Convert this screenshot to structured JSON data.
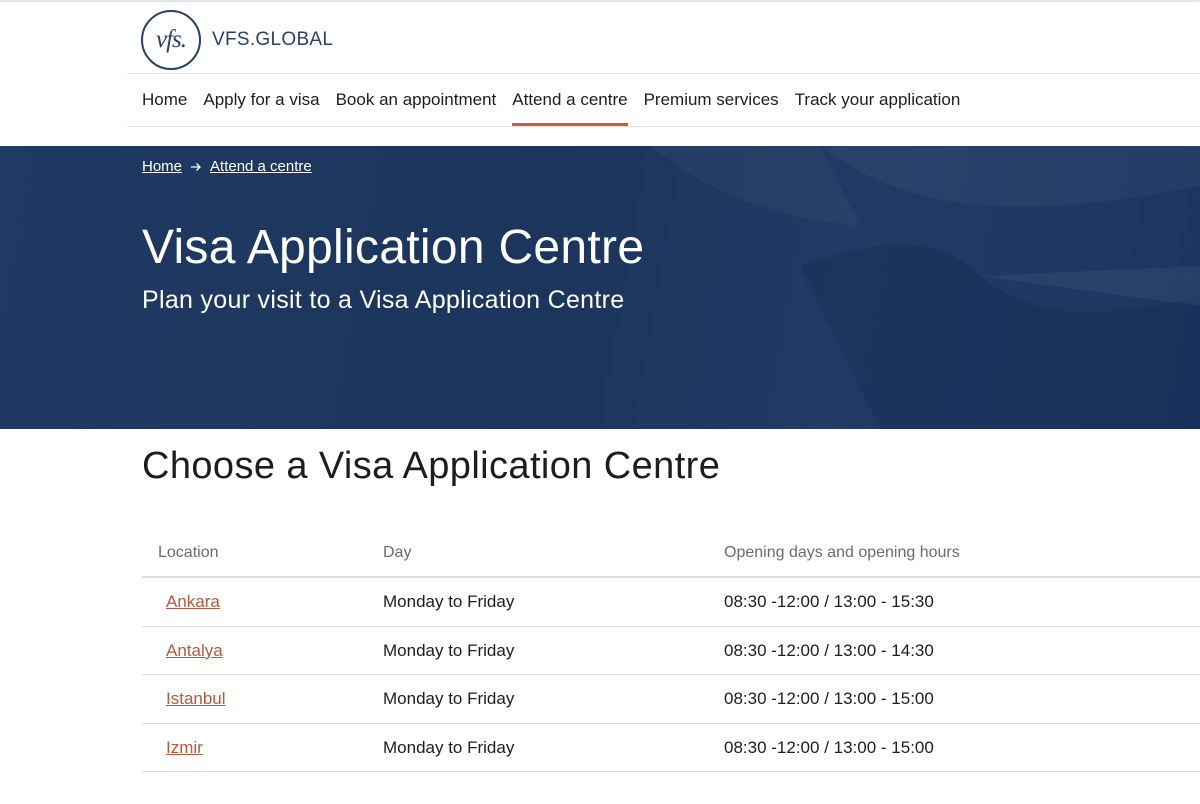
{
  "logo": {
    "mark": "vfs.",
    "wordmark": "VFS.GLOBAL"
  },
  "nav": {
    "items": [
      {
        "label": "Home",
        "active": false
      },
      {
        "label": "Apply for a visa",
        "active": false
      },
      {
        "label": "Book an appointment",
        "active": false
      },
      {
        "label": "Attend a centre",
        "active": true
      },
      {
        "label": "Premium services",
        "active": false
      },
      {
        "label": "Track your application",
        "active": false
      }
    ]
  },
  "breadcrumb": {
    "home": "Home",
    "current": "Attend a centre",
    "separator_icon": "arrow-right-icon"
  },
  "hero": {
    "title": "Visa Application Centre",
    "subtitle": "Plan your visit to a Visa Application Centre"
  },
  "section": {
    "title": "Choose a Visa Application Centre"
  },
  "table": {
    "headers": [
      "Location",
      "Day",
      "Opening days and opening hours"
    ],
    "rows": [
      {
        "location": "Ankara",
        "day": "Monday to Friday",
        "hours": "08:30 -12:00 / 13:00 - 15:30"
      },
      {
        "location": "Antalya",
        "day": "Monday to Friday",
        "hours": "08:30 -12:00 / 13:00 - 14:30"
      },
      {
        "location": "Istanbul",
        "day": "Monday to Friday",
        "hours": "08:30 -12:00 / 13:00 - 15:00"
      },
      {
        "location": "Izmir",
        "day": "Monday to Friday",
        "hours": "08:30 -12:00 / 13:00 - 15:00"
      }
    ]
  },
  "colors": {
    "brand_navy": "#2b3f67",
    "hero_background": "#1f3a63",
    "accent_link": "#b5593a",
    "active_underline": "#c0603d"
  }
}
